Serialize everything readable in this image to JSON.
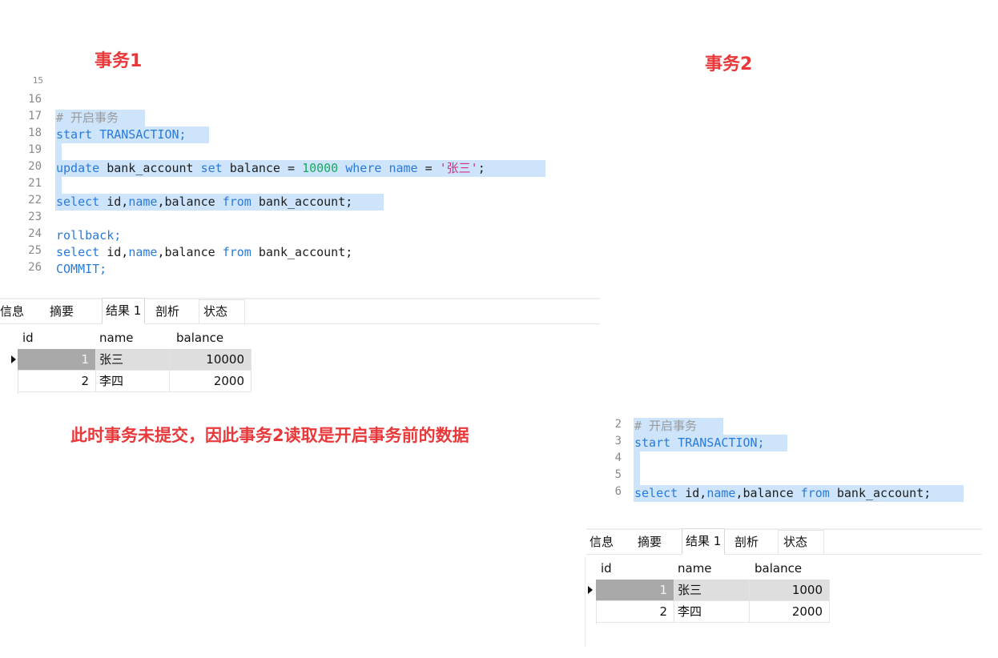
{
  "labels": {
    "tx1": "事务1",
    "tx2": "事务2",
    "note": "此时事务未提交，因此事务2读取是开启事务前的数据"
  },
  "tx1_editor": {
    "line_numbers": [
      "15",
      "16",
      "17",
      "18",
      "19",
      "20",
      "21",
      "22",
      "23",
      "24",
      "25",
      "26"
    ],
    "lines": {
      "l17": "# 开启事务",
      "l18": "start TRANSACTION;",
      "l20_update": "update",
      "l20_table": " bank_account ",
      "l20_set": "set",
      "l20_balance": " balance = ",
      "l20_value": "10000",
      "l20_where": " where ",
      "l20_name": "name",
      "l20_eq": " = ",
      "l20_str": "'张三'",
      "l20_semi": ";",
      "l22_select": "select",
      "l22_id": " id,",
      "l22_name": "name",
      "l22_rest": ",balance ",
      "l22_from": "from",
      "l22_table": " bank_account;",
      "l24": "rollback;",
      "l25_select": "select",
      "l25_id": " id,",
      "l25_name": "name",
      "l25_rest": ",balance ",
      "l25_from": "from",
      "l25_table": " bank_account;",
      "l26": "COMMIT;"
    }
  },
  "tx2_editor": {
    "line_numbers": [
      "2",
      "3",
      "4",
      "5",
      "6"
    ],
    "lines": {
      "l2": "# 开启事务",
      "l3": "start TRANSACTION;",
      "l6_select": "select",
      "l6_id": " id,",
      "l6_name": "name",
      "l6_rest": ",balance ",
      "l6_from": "from",
      "l6_table": " bank_account;"
    }
  },
  "tabs": [
    "信息",
    "摘要",
    "结果 1",
    "剖析",
    "状态"
  ],
  "active_tab": "结果 1",
  "result1": {
    "columns": [
      "id",
      "name",
      "balance"
    ],
    "rows": [
      {
        "id": "1",
        "name": "张三",
        "balance": "10000"
      },
      {
        "id": "2",
        "name": "李四",
        "balance": "2000"
      }
    ]
  },
  "result2": {
    "columns": [
      "id",
      "name",
      "balance"
    ],
    "rows": [
      {
        "id": "1",
        "name": "张三",
        "balance": "1000"
      },
      {
        "id": "2",
        "name": "李四",
        "balance": "2000"
      }
    ]
  },
  "colors": {
    "annotation": "#e8383a",
    "keyword": "#2a7ad8",
    "number": "#19a860",
    "string": "#d12f80",
    "selection": "#cde4fb"
  }
}
